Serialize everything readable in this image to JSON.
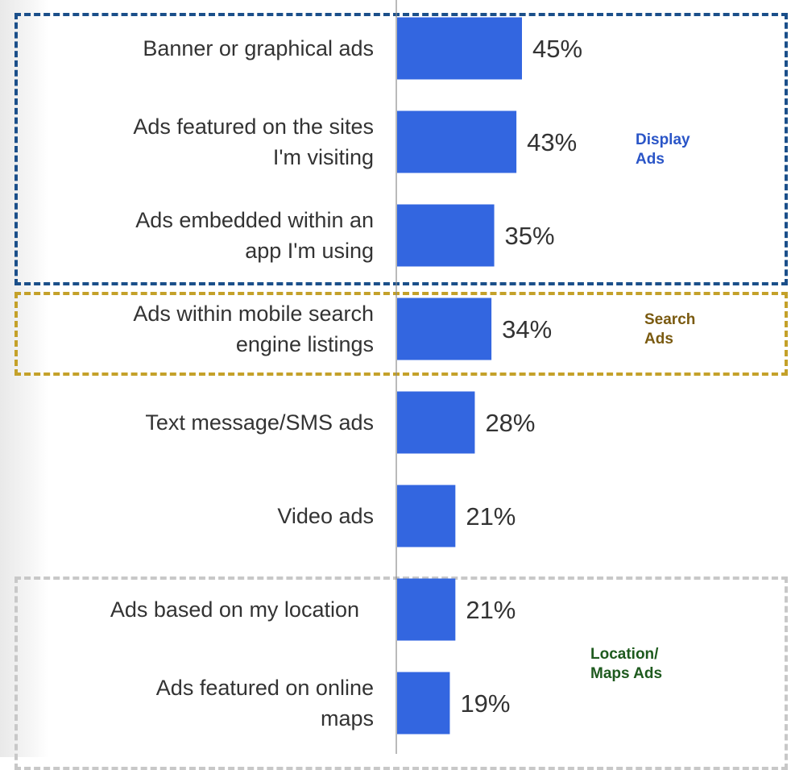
{
  "chart_data": {
    "type": "bar",
    "orientation": "horizontal",
    "categories": [
      [
        "Banner or graphical ads"
      ],
      [
        "Ads featured on the sites",
        "I'm visiting"
      ],
      [
        "Ads embedded within an",
        "app I'm using"
      ],
      [
        "Ads within mobile search",
        "engine listings"
      ],
      [
        "Text message/SMS ads"
      ],
      [
        "Video ads"
      ],
      [
        "Ads based on my location"
      ],
      [
        "Ads featured on online",
        "maps"
      ]
    ],
    "values": [
      45,
      43,
      35,
      34,
      28,
      21,
      21,
      19
    ],
    "value_labels": [
      "45%",
      "43%",
      "35%",
      "34%",
      "28%",
      "21%",
      "21%",
      "19%"
    ],
    "bar_color": "#3366e0",
    "xlim": [
      0,
      100
    ],
    "grid": false,
    "groups": [
      {
        "label": "Display\nAds",
        "color": "#1b4f8a",
        "label_color": "#2a55c7",
        "categories": [
          0,
          1,
          2
        ]
      },
      {
        "label": "Search\nAds",
        "color": "#c4a12a",
        "label_color": "#7a5a10",
        "categories": [
          3
        ]
      },
      {
        "label": "Location/\nMaps Ads",
        "color": "#c8c8c8",
        "label_color": "#1e5a1e",
        "categories": [
          6,
          7
        ]
      }
    ]
  }
}
